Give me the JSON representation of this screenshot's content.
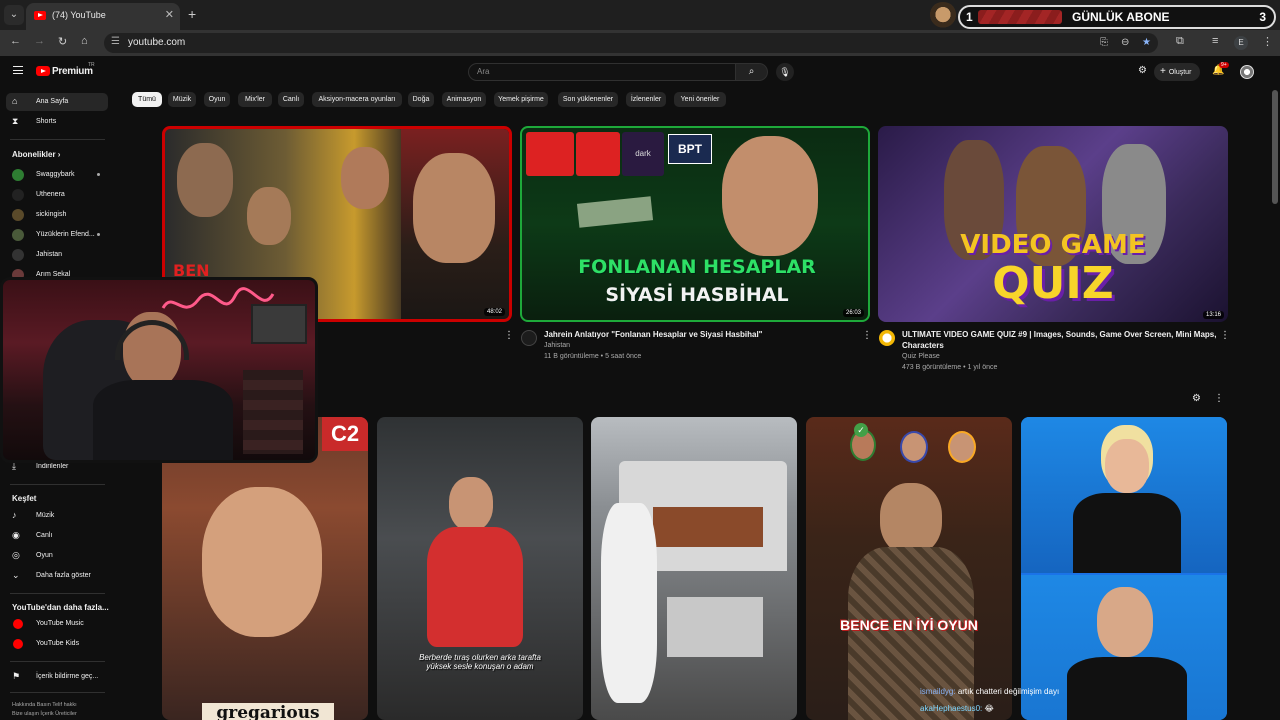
{
  "browser": {
    "tab_title": "(74) YouTube",
    "url": "youtube.com",
    "profile_letter": "E",
    "icons": [
      "tab-dropdown-icon",
      "back-icon",
      "forward-icon",
      "reload-icon",
      "home-icon",
      "site-settings-icon",
      "install-app-icon",
      "zoom-icon",
      "bookmark-star-icon",
      "extensions-icon",
      "reading-list-icon",
      "menu-dots-icon"
    ]
  },
  "subscriber_widget": {
    "left_number": "1",
    "title": "GÜNLÜK ABONE",
    "right_number": "3"
  },
  "header": {
    "brand": "Premium",
    "region": "TR",
    "search_placeholder": "Ara",
    "create_label": "Oluştur",
    "notification_badge": "9+"
  },
  "chips": [
    "Tümü",
    "Müzik",
    "Oyun",
    "Mix'ler",
    "Canlı",
    "Aksiyon-macera oyunları",
    "Doğa",
    "Animasyon",
    "Yemek pişirme",
    "Son yüklenenler",
    "İzlenenler",
    "Yeni öneriler"
  ],
  "sidebar": {
    "home": "Ana Sayfa",
    "shorts": "Shorts",
    "subscriptions_heading": "Abonelikler",
    "channels": [
      "Swaggybark",
      "Uthenera",
      "sickingish",
      "Yüzüklerin Efend...",
      "Jahistan",
      "Arım Sekal"
    ],
    "downloads": "İndirilenler",
    "explore_heading": "Keşfet",
    "explore": [
      "Müzik",
      "Canlı",
      "Oyun",
      "Daha fazla göster"
    ],
    "more_heading": "YouTube'dan daha fazla...",
    "more": [
      "YouTube Music",
      "YouTube Kids"
    ],
    "report": "İçerik bildirme geç...",
    "footer_line1": "Hakkında   Basın   Telif hakkı",
    "footer_line2": "Bize ulaşın   İçerik Üreticiler"
  },
  "videos": [
    {
      "duration": "48:02",
      "thumb_text": "BEN"
    },
    {
      "title": "Jahrein Anlatıyor \"Fonlanan Hesaplar ve Siyasi Hasbihal\"",
      "channel": "Jahistan",
      "meta": "11 B görüntüleme • 5 saat önce",
      "duration": "26:03",
      "thumb_line1": "FONLANAN HESAPLAR",
      "thumb_line2": "SİYASİ HASBİHAL",
      "thumb_brands": [
        "dark",
        "BPT"
      ]
    },
    {
      "title_line1": "ULTIMATE VIDEO GAME QUIZ #9 | Images, Sounds, Game Over Screen, Mini Maps,",
      "title_line2": "Characters",
      "channel": "Quiz Please",
      "meta": "473 B görüntüleme • 1 yıl önce",
      "duration": "13:16",
      "thumb_line1": "VIDEO GAME",
      "thumb_line2": "QUIZ"
    }
  ],
  "shorts": [
    {
      "badge": "C2",
      "caption": "gregarious"
    },
    {
      "caption": "Berberde tıraş olurken arka tarafta yüksek sesle konuşan o adam"
    },
    {
      "caption": ""
    },
    {
      "caption": "BENCE EN İYİ OYUN"
    },
    {
      "caption": ""
    }
  ],
  "chat": [
    {
      "user": "ismaildyg:",
      "message": "artık chatteri değilmişim dayı"
    },
    {
      "user": "akaHephaestus0:",
      "message": "😂"
    }
  ],
  "colors": {
    "background": "#0f0f0f",
    "youtube_red": "#ff0000",
    "chip_bg": "#272727"
  }
}
